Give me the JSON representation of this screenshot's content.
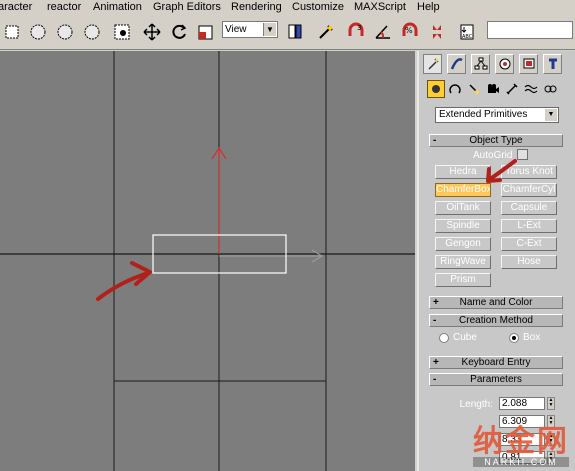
{
  "menu": [
    "aracter",
    "reactor",
    "Animation",
    "Graph Editors",
    "Rendering",
    "Customize",
    "MAXScript",
    "Help"
  ],
  "toolbar": {
    "view_select": "View",
    "icons": [
      "select-object-icon",
      "select-circle-icon",
      "select-region-icon",
      "select-fence-icon",
      "select-filter-icon",
      "move-icon",
      "rotate-icon",
      "scale-icon",
      "mirror-icon",
      "align-icon",
      "snap-icon",
      "angle-snap-icon",
      "percent-snap-icon",
      "spinner-snap-icon",
      "edit-named-selection-icon"
    ]
  },
  "command_panel": {
    "tabs": [
      "create-tab",
      "modify-tab",
      "hierarchy-tab",
      "motion-tab",
      "display-tab",
      "utilities-tab"
    ],
    "subcategories": [
      "geometry-icon",
      "shapes-icon",
      "lights-icon",
      "cameras-icon",
      "helpers-icon",
      "space-warps-icon",
      "systems-icon"
    ],
    "category_dropdown": "Extended Primitives",
    "object_type": {
      "title": "Object Type",
      "autogrid": "AutoGrid",
      "buttons": [
        [
          "Hedra",
          "Torus Knot"
        ],
        [
          "ChamferBox",
          "ChamferCyl"
        ],
        [
          "OilTank",
          "Capsule"
        ],
        [
          "Spindle",
          "L-Ext"
        ],
        [
          "Gengon",
          "C-Ext"
        ],
        [
          "RingWave",
          "Hose"
        ],
        [
          "Prism",
          ""
        ]
      ],
      "active": "ChamferBox"
    },
    "name_and_color": "Name and Color",
    "creation_method": {
      "title": "Creation Method",
      "options": [
        "Cube",
        "Box"
      ],
      "selected": "Box"
    },
    "keyboard_entry": "Keyboard Entry",
    "parameters": {
      "title": "Parameters",
      "length_label": "Length:",
      "length_value": "2.088",
      "width_value": "6.309",
      "height_value": "8.33",
      "fillet_value": "0.81"
    }
  },
  "watermark": {
    "big": "纳金网",
    "small": "NARKII.COM"
  },
  "colors": {
    "highlight": "#ffc75a",
    "annotation_arrow": "#b0211c",
    "viewport_bg": "#7d7d7d"
  }
}
